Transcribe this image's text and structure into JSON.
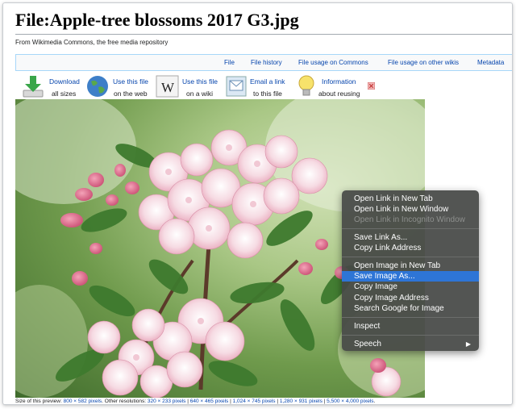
{
  "page": {
    "title": "File:Apple-tree blossoms 2017 G3.jpg",
    "subtitle": "From Wikimedia Commons, the free media repository"
  },
  "tabs": [
    "File",
    "File history",
    "File usage on Commons",
    "File usage on other wikis",
    "Metadata"
  ],
  "tools": {
    "download": {
      "line1": "Download",
      "line2": "all sizes",
      "icon": "download-icon"
    },
    "web": {
      "line1": "Use this file",
      "line2": "on the web",
      "icon": "globe-icon"
    },
    "wiki": {
      "line1": "Use this file",
      "line2": "on a wiki",
      "icon": "wikipedia-icon"
    },
    "email": {
      "line1": "Email a link",
      "line2": "to this file",
      "icon": "email-icon"
    },
    "info": {
      "line1": "Information",
      "line2": "about reusing",
      "icon": "lightbulb-icon"
    },
    "close_icon": "close-icon"
  },
  "caption": {
    "prefix": "Size of this preview:",
    "preview": "800 × 582 pixels",
    "mid": ". Other resolutions:",
    "res1": "320 × 233 pixels",
    "sep": "|",
    "res2": "640 × 465 pixels",
    "res3": "1,024 × 745 pixels",
    "res4": "1,280 × 931 pixels",
    "res5": "5,500 × 4,000 pixels",
    "end": "."
  },
  "context_menu": {
    "open_link_new_tab": "Open Link in New Tab",
    "open_link_new_window": "Open Link in New Window",
    "open_link_incognito": "Open Link in Incognito Window",
    "save_link_as": "Save Link As...",
    "copy_link_address": "Copy Link Address",
    "open_image_new_tab": "Open Image in New Tab",
    "save_image_as": "Save Image As...",
    "copy_image": "Copy Image",
    "copy_image_address": "Copy Image Address",
    "search_google": "Search Google for Image",
    "inspect": "Inspect",
    "speech": "Speech",
    "submenu_arrow": "▶"
  },
  "colors": {
    "link": "#0645ad",
    "highlight": "#2e75d6",
    "menu_bg": "#464846"
  }
}
